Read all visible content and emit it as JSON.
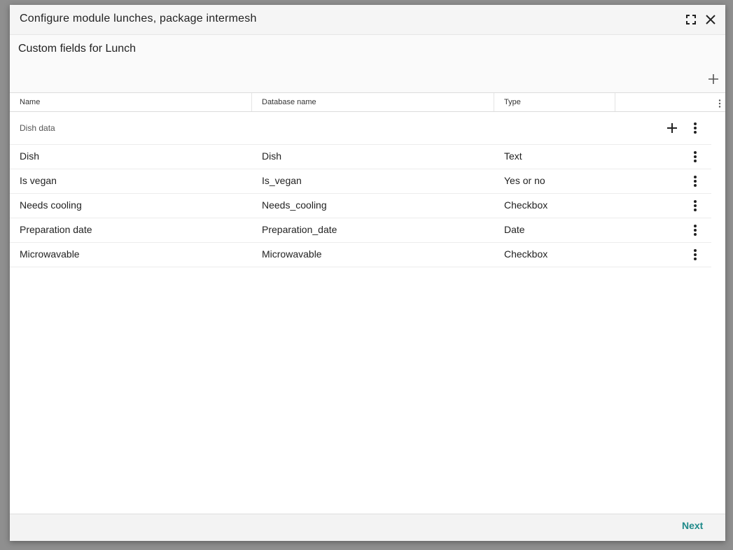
{
  "dialog": {
    "title": "Configure module lunches, package intermesh",
    "icons": {
      "maximize": "maximize-icon",
      "close": "close-icon"
    }
  },
  "panel": {
    "title": "Custom fields for Lunch",
    "add_icon": "plus-icon"
  },
  "table": {
    "columns": [
      "Name",
      "Database name",
      "Type",
      ""
    ],
    "group": {
      "label": "Dish data",
      "add_icon": "plus-icon",
      "menu_icon": "more-vertical-icon"
    },
    "rows": [
      {
        "name": "Dish",
        "database_name": "Dish",
        "type": "Text"
      },
      {
        "name": "Is vegan",
        "database_name": "Is_vegan",
        "type": "Yes or no"
      },
      {
        "name": "Needs cooling",
        "database_name": "Needs_cooling",
        "type": "Checkbox"
      },
      {
        "name": "Preparation date",
        "database_name": "Preparation_date",
        "type": "Date"
      },
      {
        "name": "Microwavable",
        "database_name": "Microwavable",
        "type": "Checkbox"
      }
    ]
  },
  "footer": {
    "next_label": "Next"
  },
  "colors": {
    "accent": "#1f8a8a",
    "text": "#222222",
    "titlebar_bg": "#f5f5f5",
    "footer_bg": "#f3f3f3"
  }
}
